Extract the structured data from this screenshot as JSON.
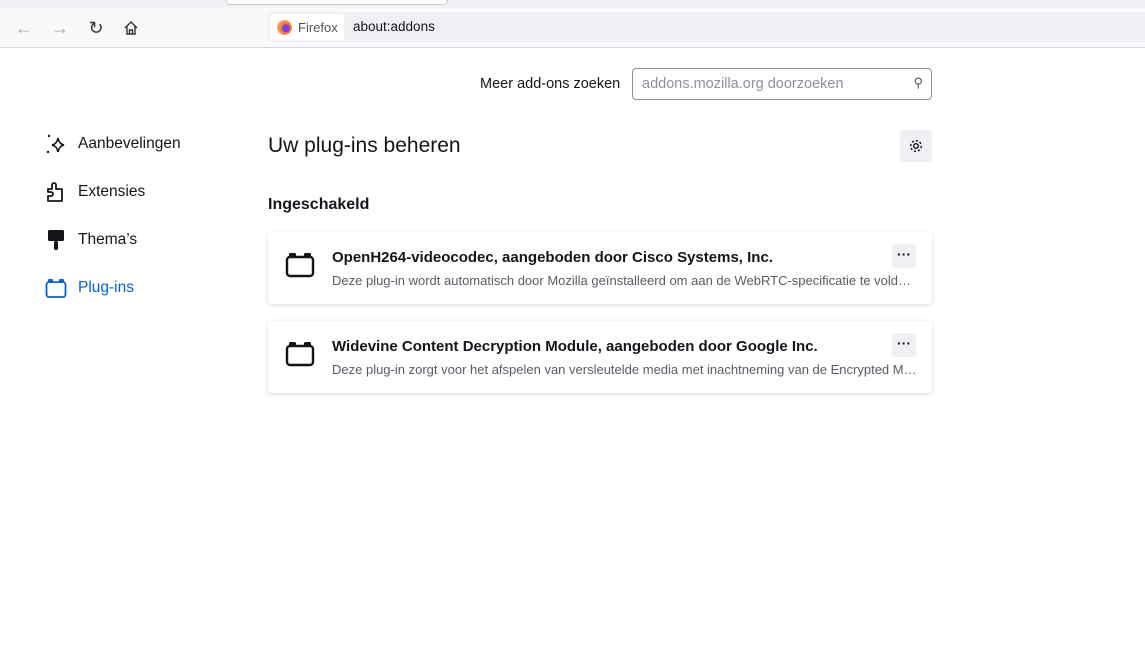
{
  "browser": {
    "identity_label": "Firefox",
    "url": "about:addons"
  },
  "search": {
    "label": "Meer add-ons zoeken",
    "placeholder": "addons.mozilla.org doorzoeken"
  },
  "sidebar": {
    "items": [
      {
        "label": "Aanbevelingen"
      },
      {
        "label": "Extensies"
      },
      {
        "label": "Thema’s"
      },
      {
        "label": "Plug-ins",
        "selected": true
      }
    ]
  },
  "main": {
    "title": "Uw plug-ins beheren",
    "section": "Ingeschakeld",
    "plugins": [
      {
        "name": "OpenH264-videocodec, aangeboden door Cisco Systems, Inc.",
        "description": "Deze plug-in wordt automatisch door Mozilla geïnstalleerd om aan de WebRTC-specificatie te voldoen",
        "more": "···"
      },
      {
        "name": "Widevine Content Decryption Module, aangeboden door Google Inc.",
        "description": "Deze plug-in zorgt voor het afspelen van versleutelde media met inachtneming van de Encrypted Media Extensions-specificatie",
        "more": "···"
      }
    ]
  },
  "colors": {
    "accent": "#0061e0"
  }
}
